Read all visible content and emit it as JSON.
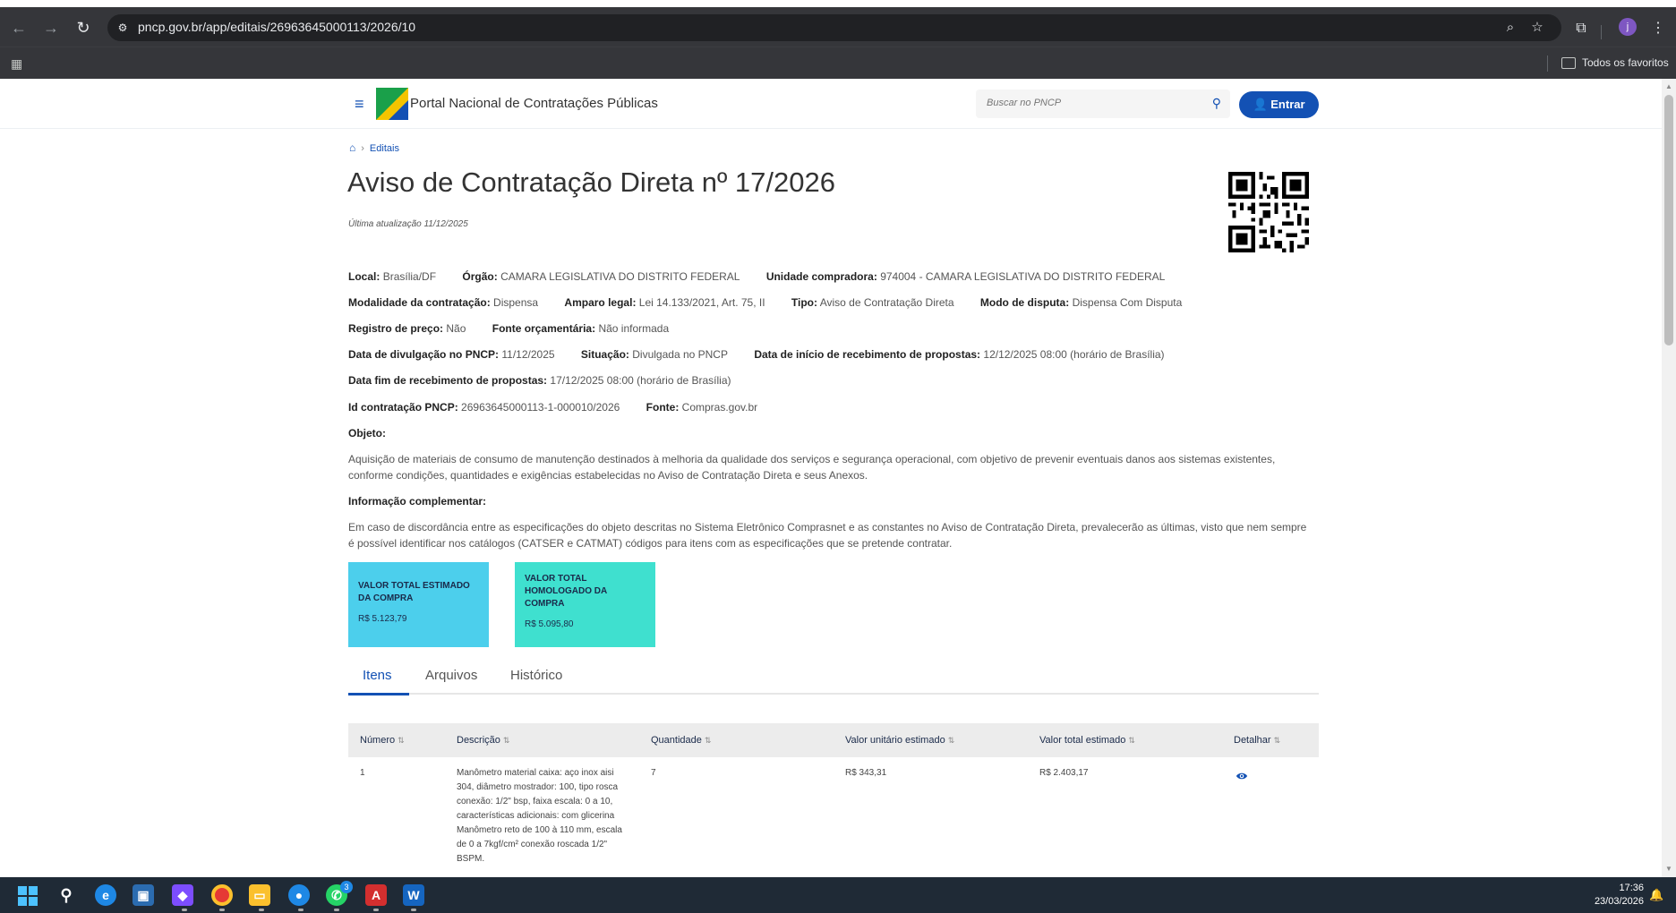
{
  "browser": {
    "url": "pncp.gov.br/app/editais/26963645000113/2026/10",
    "bookmarks_folder": "Todos os favoritos",
    "profile_initial": "j"
  },
  "header": {
    "portal_title": "Portal Nacional de Contratações Públicas",
    "search_placeholder": "Buscar no PNCP",
    "login_label": "Entrar"
  },
  "breadcrumb": {
    "current": "Editais"
  },
  "title": "Aviso de Contratação Direta nº 17/2026",
  "updated": "Última atualização 11/12/2025",
  "info": {
    "local_label": "Local:",
    "local": "Brasília/DF",
    "orgao_label": "Órgão:",
    "orgao": "CAMARA LEGISLATIVA DO DISTRITO FEDERAL",
    "unidade_label": "Unidade compradora:",
    "unidade": "974004 - CAMARA LEGISLATIVA DO DISTRITO FEDERAL",
    "modalidade_label": "Modalidade da contratação:",
    "modalidade": "Dispensa",
    "amparo_label": "Amparo legal:",
    "amparo": "Lei 14.133/2021, Art. 75, II",
    "tipo_label": "Tipo:",
    "tipo": "Aviso de Contratação Direta",
    "modo_label": "Modo de disputa:",
    "modo": "Dispensa Com Disputa",
    "registro_label": "Registro de preço:",
    "registro": "Não",
    "fonte_orc_label": "Fonte orçamentária:",
    "fonte_orc": "Não informada",
    "divulgacao_label": "Data de divulgação no PNCP:",
    "divulgacao": "11/12/2025",
    "situacao_label": "Situação:",
    "situacao": "Divulgada no PNCP",
    "inicio_label": "Data de início de recebimento de propostas:",
    "inicio": "12/12/2025 08:00 (horário de Brasília)",
    "fim_label": "Data fim de recebimento de propostas:",
    "fim": "17/12/2025 08:00 (horário de Brasília)",
    "id_label": "Id contratação PNCP:",
    "id": "26963645000113-1-000010/2026",
    "fonte_label": "Fonte:",
    "fonte": "Compras.gov.br",
    "objeto_label": "Objeto:",
    "objeto": "Aquisição de materiais de consumo de manutenção destinados à melhoria da qualidade dos serviços e segurança operacional, com objetivo de prevenir eventuais danos aos sistemas existentes, conforme condições, quantidades e exigências estabelecidas no Aviso de Contratação Direta e seus Anexos.",
    "complementar_label": "Informação complementar:",
    "complementar": "Em caso de discordância entre as especificações do objeto descritas no Sistema Eletrônico Comprasnet e as constantes no Aviso de Contratação Direta, prevalecerão as últimas, visto que nem sempre é possível identificar nos catálogos (CATSER e CATMAT) códigos para itens com as especificações que se pretende contratar."
  },
  "cards": {
    "estimado_label": "VALOR TOTAL ESTIMADO DA COMPRA",
    "estimado_value": "R$ 5.123,79",
    "homologado_label": "VALOR TOTAL HOMOLOGADO DA COMPRA",
    "homologado_value": "R$ 5.095,80"
  },
  "tabs": [
    "Itens",
    "Arquivos",
    "Histórico"
  ],
  "table": {
    "headers": [
      "Número",
      "Descrição",
      "Quantidade",
      "Valor unitário estimado",
      "Valor total estimado",
      "Detalhar"
    ],
    "rows": [
      {
        "numero": "1",
        "descricao": "Manômetro material caixa: aço inox aisi 304, diâmetro mostrador: 100, tipo rosca conexão: 1/2\" bsp, faixa escala: 0 a 10, características adicionais: com glicerina Manômetro reto de 100 à 110 mm, escala de 0 a 7kgf/cm² conexão roscada 1/2\" BSPM.",
        "quantidade": "7",
        "valor_unitario": "R$ 343,31",
        "valor_total": "R$ 2.403,17"
      }
    ]
  },
  "taskbar": {
    "time": "17:36",
    "date": "23/03/2026",
    "whatsapp_badge": "3"
  },
  "colors": {
    "primary": "#1351b4",
    "card_blue": "#4ccfec",
    "card_green": "#3fe0cf"
  }
}
